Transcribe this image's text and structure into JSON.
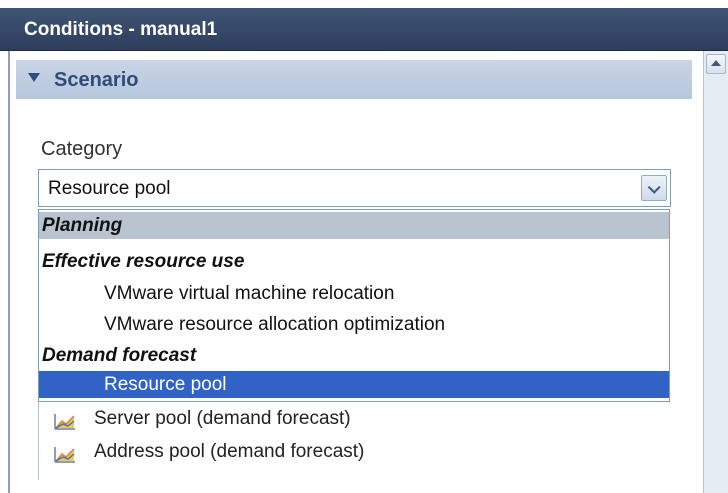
{
  "window": {
    "title": "Conditions - manual1"
  },
  "section": {
    "label": "Scenario",
    "icon": "collapse-triangle-icon"
  },
  "category": {
    "label": "Category",
    "selected_value": "Resource pool"
  },
  "dropdown": {
    "options": [
      {
        "label": "Planning",
        "kind": "group"
      },
      {
        "label": "Effective resource use",
        "kind": "group"
      },
      {
        "label": "VMware virtual machine relocation",
        "kind": "option"
      },
      {
        "label": "VMware resource allocation optimization",
        "kind": "option"
      },
      {
        "label": "Demand forecast",
        "kind": "group"
      },
      {
        "label": "Resource pool",
        "kind": "option",
        "selected": true
      }
    ]
  },
  "list": {
    "items": [
      {
        "label": "Server pool (demand forecast)",
        "icon": "chart-icon"
      },
      {
        "label": "Address pool (demand forecast)",
        "icon": "chart-icon"
      }
    ]
  },
  "colors": {
    "title_bar": "#2d3e5b",
    "section_header": "#b6c6dc",
    "group_highlight": "#b9c4d0",
    "selection": "#3163c5"
  }
}
